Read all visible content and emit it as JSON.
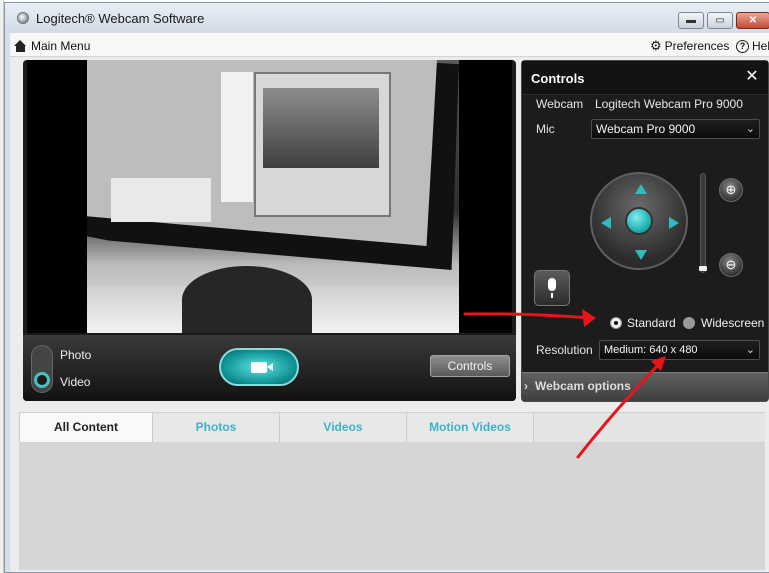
{
  "window": {
    "title": "Logitech® Webcam Software",
    "min_label": "▬",
    "max_label": "▭",
    "close_label": "✕"
  },
  "menubar": {
    "main_menu": "Main Menu",
    "preferences": "Preferences",
    "help": "Help"
  },
  "camera_bar": {
    "photo_label": "Photo",
    "video_label": "Video",
    "selected_mode": "Video",
    "controls_button": "Controls"
  },
  "controls": {
    "title": "Controls",
    "webcam_label": "Webcam",
    "webcam_value": "Logitech Webcam Pro 9000",
    "mic_label": "Mic",
    "mic_value": "Webcam Pro 9000",
    "zoom_in_icon": "⊕",
    "zoom_out_icon": "⊖",
    "aspect_standard": "Standard",
    "aspect_widescreen": "Widescreen",
    "aspect_selected": "Standard",
    "resolution_label": "Resolution",
    "resolution_value": "Medium: 640 x 480",
    "webcam_options": "Webcam options"
  },
  "tabs": [
    {
      "label": "All Content",
      "active": true
    },
    {
      "label": "Photos",
      "active": false
    },
    {
      "label": "Videos",
      "active": false
    },
    {
      "label": "Motion Videos",
      "active": false
    }
  ],
  "colors": {
    "accent_teal": "#2dbdbf",
    "tab_text": "#3bb3c8",
    "annotation_red": "#e8141b"
  },
  "icons": {
    "home": "home-icon",
    "gear": "gear-icon",
    "help": "help-icon",
    "record": "video-camera-icon",
    "mic": "microphone-icon",
    "close": "close-icon"
  }
}
